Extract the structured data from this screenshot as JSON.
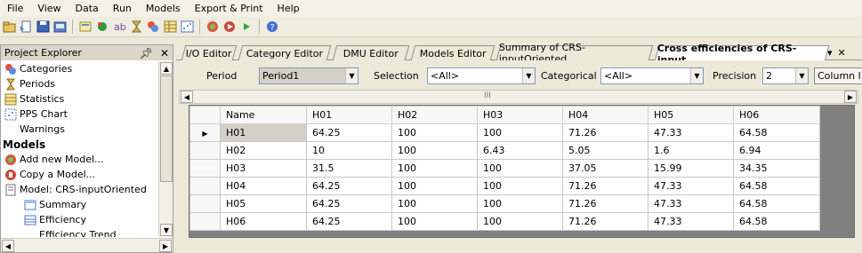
{
  "menu": [
    "File",
    "View",
    "Data",
    "Run",
    "Models",
    "Export & Print",
    "Help"
  ],
  "toolbar_icons": [
    "open-icon",
    "new-project-icon",
    "save-icon",
    "save-as-icon",
    "import-icon",
    "data-wizard-icon",
    "spell-icon",
    "period-icon",
    "categories-icon",
    "table-icon",
    "chart-icon",
    "model-icon",
    "model-run-icon",
    "play-icon",
    "help-icon"
  ],
  "explorer": {
    "title": "Project Explorer",
    "pin": "2",
    "close": "✕",
    "items": [
      {
        "label": "Categories",
        "icon": "categories-icon",
        "bold": false
      },
      {
        "label": "Periods",
        "icon": "hourglass-icon",
        "bold": false
      },
      {
        "label": "Statistics",
        "icon": "statistics-icon",
        "bold": false
      },
      {
        "label": "PPS Chart",
        "icon": "chart-icon",
        "bold": false
      },
      {
        "label": "Warnings",
        "icon": "",
        "bold": false
      },
      {
        "label": "Models",
        "icon": "",
        "bold": true
      },
      {
        "label": "Add new Model...",
        "icon": "add-model-icon",
        "bold": false
      },
      {
        "label": "Copy a Model...",
        "icon": "copy-model-icon",
        "bold": false
      },
      {
        "label": "Model: CRS-inputOriented",
        "icon": "model-icon",
        "bold": false
      },
      {
        "label": "Summary",
        "icon": "summary-icon",
        "bold": false
      },
      {
        "label": "Efficiency",
        "icon": "efficiency-icon",
        "bold": false
      },
      {
        "label": "Efficiency Trend",
        "icon": "",
        "bold": false
      }
    ]
  },
  "tabs": [
    {
      "label": "I/O Editor",
      "active": false
    },
    {
      "label": "Category Editor",
      "active": false
    },
    {
      "label": "DMU Editor",
      "active": false
    },
    {
      "label": "Models Editor",
      "active": false
    },
    {
      "label": "Summary of CRS-inputOriented",
      "active": false
    },
    {
      "label": "Cross efficiencies of CRS-input...",
      "active": true
    }
  ],
  "tab_controls": {
    "dropdown": "▾",
    "close": "✕"
  },
  "filters": {
    "period_label": "Period",
    "period_value": "Period1",
    "selection_label": "Selection",
    "selection_value": "<All>",
    "categorical_label": "Categorical",
    "categorical_value": "<All>",
    "precision_label": "Precision",
    "precision_value": "2",
    "column_button": "Column l"
  },
  "scroll_mid": "III",
  "grid": {
    "columns": [
      "Name",
      "H01",
      "H02",
      "H03",
      "H04",
      "H05",
      "H06"
    ],
    "rows": [
      [
        "H01",
        "64.25",
        "100",
        "100",
        "71.26",
        "47.33",
        "64.58"
      ],
      [
        "H02",
        "10",
        "100",
        "6.43",
        "5.05",
        "1.6",
        "6.94"
      ],
      [
        "H03",
        "31.5",
        "100",
        "100",
        "37.05",
        "15.99",
        "34.35"
      ],
      [
        "H04",
        "64.25",
        "100",
        "100",
        "71.26",
        "47.33",
        "64.58"
      ],
      [
        "H05",
        "64.25",
        "100",
        "100",
        "71.26",
        "47.33",
        "64.58"
      ],
      [
        "H06",
        "64.25",
        "100",
        "100",
        "71.26",
        "47.33",
        "64.58"
      ]
    ],
    "current_row_marker": "▶"
  }
}
